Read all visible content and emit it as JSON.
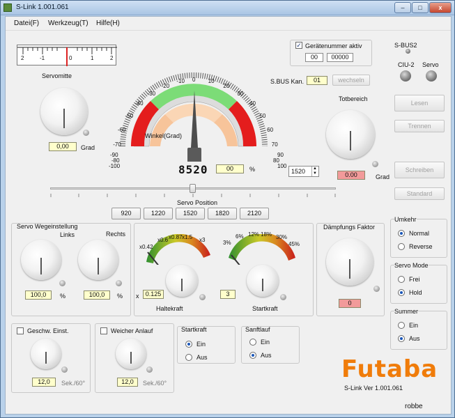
{
  "window": {
    "title": "S-Link 1.001.061",
    "minimize": "–",
    "maximize": "□",
    "close": "x"
  },
  "menu": [
    "Datei(F)",
    "Werkzeug(T)",
    "Hilfe(H)"
  ],
  "top_scale": {
    "labels": [
      "2",
      "-1",
      "0",
      "1",
      "2"
    ]
  },
  "servomitte": {
    "label": "Servomitte",
    "value": "0,00",
    "unit": "Grad"
  },
  "gauge": {
    "top_ticks": [
      "-80",
      "-70",
      "-60",
      "-50",
      "-40",
      "-30",
      "-20",
      "-10",
      "0",
      "10",
      "20",
      "30",
      "40",
      "50",
      "60",
      "70",
      "80"
    ],
    "left_ticks": [
      "-90",
      "-100"
    ],
    "right_ticks": [
      "90",
      "100"
    ],
    "center_label": "Winkel(Grad)",
    "digital_readout": "8520",
    "percent_value": "00",
    "percent_unit": "%",
    "spin_value": "1520"
  },
  "servo_position": {
    "label": "Servo Position",
    "presets": [
      "920",
      "1220",
      "1520",
      "1820",
      "2120"
    ]
  },
  "geraetenummer": {
    "label": "Gerätenummer aktiv",
    "checked": true,
    "value1": "00",
    "value2": "00000"
  },
  "sbus": {
    "label": "S.BUS Kan.",
    "value": "01",
    "button": "wechseln"
  },
  "connectors": {
    "sbus2": "S-BUS2",
    "ciu2": "CIU-2",
    "servo": "Servo"
  },
  "totbereich": {
    "label": "Totbereich",
    "value": "0.00",
    "unit": "Grad"
  },
  "side_buttons": [
    "Lesen",
    "Trennen",
    "Schreiben",
    "Standard"
  ],
  "weg": {
    "title": "Servo Wegeinstellung",
    "left_label": "Links",
    "right_label": "Rechts",
    "left_value": "100,0",
    "right_value": "100,0",
    "unit": "%"
  },
  "haltekraft": {
    "marks": [
      "x0.42",
      "x0.6",
      "x0.87",
      "x1.5",
      "x3"
    ],
    "prefix": "x",
    "value": "0.125",
    "label": "Haltekraft"
  },
  "startkraft": {
    "marks": [
      "3%",
      "6%",
      "12%",
      "18%",
      "30%",
      "45%"
    ],
    "value": "3",
    "label": "Startkraft"
  },
  "daempfung": {
    "label": "Dämpfungs Faktor",
    "value": "0"
  },
  "umkehr": {
    "title": "Umkehr",
    "options": [
      "Normal",
      "Reverse"
    ],
    "selected": "Normal"
  },
  "servo_mode": {
    "title": "Servo Mode",
    "options": [
      "Frei",
      "Hold"
    ],
    "selected": "Hold"
  },
  "summer": {
    "title": "Summer",
    "options": [
      "Ein",
      "Aus"
    ],
    "selected": "Aus"
  },
  "geschw": {
    "label": "Geschw. Einst.",
    "value": "12,0",
    "unit": "Sek./60°"
  },
  "weicher": {
    "label": "Weicher Anlauf",
    "value": "12,0",
    "unit": "Sek./60°"
  },
  "startkraft_group": {
    "title": "Startkraft",
    "options": [
      "Ein",
      "Aus"
    ],
    "selected": "Ein"
  },
  "sanftlauf": {
    "title": "Sanftlauf",
    "options": [
      "Ein",
      "Aus"
    ],
    "selected": "Aus"
  },
  "brand": {
    "logo": "Futaba",
    "version": "S-Link  Ver 1.001.061",
    "robbe": "robbe",
    "logo_color": "#f07c0a"
  }
}
